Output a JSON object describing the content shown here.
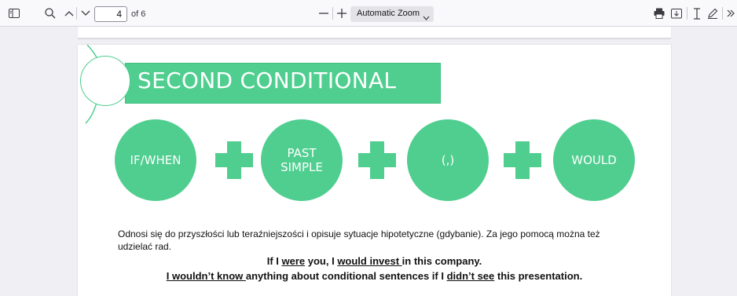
{
  "toolbar": {
    "page_number": "4",
    "page_count": "of 6",
    "zoom_label": "Automatic Zoom"
  },
  "slide": {
    "title": "SECOND CONDITIONAL",
    "formula": [
      "IF/WHEN",
      "PAST SIMPLE",
      "(,)",
      "WOULD"
    ],
    "description": "Odnosi się do przyszłości lub teraźniejszości i opisuje sytuacje hipotetyczne (gdybanie). Za jego pomocą można też udzielać rad.",
    "example1": {
      "p1": "If I ",
      "u1": "were",
      "p2": " you, I ",
      "u2": "would invest ",
      "p3": "in this company."
    },
    "example2": {
      "u1": "I wouldn’t know ",
      "p1": "anything about conditional sentences if I ",
      "u2": "didn’t see",
      "p2": " this presentation."
    }
  },
  "colors": {
    "accent": "#4fce8f"
  }
}
